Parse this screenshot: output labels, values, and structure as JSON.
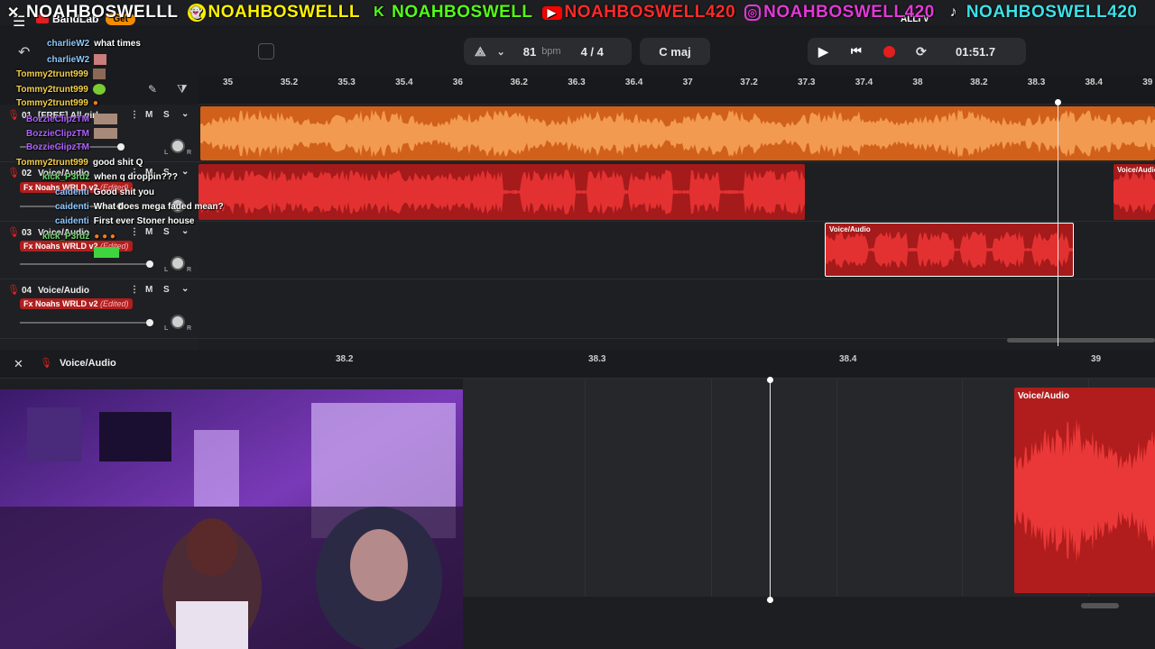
{
  "banner": {
    "items": [
      {
        "platform": "x",
        "handle": "NOAHBOSWELLL",
        "color": "#ffffff",
        "icon": "x-icon"
      },
      {
        "platform": "snapchat",
        "handle": "NOAHBOSWELLL",
        "color": "#fff200",
        "icon": "snapchat-icon"
      },
      {
        "platform": "kick",
        "handle": "NOAHBOSWELL",
        "color": "#53fc18",
        "icon": "kick-icon"
      },
      {
        "platform": "youtube",
        "handle": "NOAHBOSWELL420",
        "color": "#ff2a2a",
        "icon": "youtube-icon"
      },
      {
        "platform": "instagram",
        "handle": "NOAHBOSWELL420",
        "color": "#e239d6",
        "icon": "instagram-icon"
      },
      {
        "platform": "tiktok",
        "handle": "NOAHBOSWELL420",
        "color": "#3ce0e8",
        "icon": "tiktok-icon"
      }
    ]
  },
  "app": {
    "name": "BandLab",
    "get_label": "Get",
    "user_label": "ALLI V"
  },
  "transport": {
    "bpm": "81",
    "bpm_unit": "bpm",
    "time_signature": "4 / 4",
    "key": "C maj",
    "time": "01:51.7"
  },
  "ruler": {
    "ticks": [
      "35",
      "35.2",
      "35.3",
      "35.4",
      "36",
      "36.2",
      "36.3",
      "36.4",
      "37",
      "37.2",
      "37.3",
      "37.4",
      "38",
      "38.2",
      "38.3",
      "38.4",
      "39"
    ]
  },
  "tracks": [
    {
      "num": "01",
      "name": "[FREE] All girl...",
      "fx": "",
      "fx_edited": "",
      "mute": "M",
      "solo": "S"
    },
    {
      "num": "02",
      "name": "Voice/Audio",
      "fx": "Fx Noahs WRLD v2",
      "fx_edited": "(Edited)",
      "mute": "M",
      "solo": "S"
    },
    {
      "num": "03",
      "name": "Voice/Audio",
      "fx": "Fx Noahs WRLD v2",
      "fx_edited": "(Edited)",
      "mute": "M",
      "solo": "S"
    },
    {
      "num": "04",
      "name": "Voice/Audio",
      "fx": "Fx Noahs WRLD v2",
      "fx_edited": "(Edited)",
      "mute": "M",
      "solo": "S"
    }
  ],
  "clips": {
    "track2_right_label": "Voice/Audio",
    "track3_label": "Voice/Audio"
  },
  "pan": {
    "left": "L",
    "right": "R"
  },
  "editor": {
    "title": "Voice/Audio",
    "ticks": [
      "38.2",
      "38.3",
      "38.4",
      "39"
    ],
    "clip_label": "Voice/Audio"
  },
  "chat": [
    {
      "user": "charlieW2",
      "msg": "what times",
      "ucolor": "#8fc8ff"
    },
    {
      "user": "charlieW2",
      "msg": "",
      "ucolor": "#8fc8ff"
    },
    {
      "user": "Tommy2trunt999",
      "msg": "",
      "ucolor": "#f4d04a"
    },
    {
      "user": "Tommy2trunt999",
      "msg": "",
      "ucolor": "#f4d04a"
    },
    {
      "user": "Tommy2trunt999",
      "msg": "",
      "ucolor": "#f4d04a"
    },
    {
      "user": "BozzieClipzTM",
      "msg": "",
      "ucolor": "#b060ff"
    },
    {
      "user": "BozzieClipzTM",
      "msg": "",
      "ucolor": "#b060ff"
    },
    {
      "user": "BozzieClipzTM",
      "msg": "",
      "ucolor": "#b060ff"
    },
    {
      "user": "Tommy2trunt999",
      "msg": "good shit Q",
      "ucolor": "#f4d04a"
    },
    {
      "user": "kick_P3rdz",
      "msg": "when q droppin???",
      "ucolor": "#6fd96f"
    },
    {
      "user": "caidenti",
      "msg": "Good shit you",
      "ucolor": "#8fc8ff"
    },
    {
      "user": "caidenti",
      "msg": "What does mega faded mean?",
      "ucolor": "#8fc8ff"
    },
    {
      "user": "caidenti",
      "msg": "First ever Stoner house",
      "ucolor": "#8fc8ff"
    },
    {
      "user": "kick_P3rdz",
      "msg": "",
      "ucolor": "#6fd96f"
    }
  ]
}
